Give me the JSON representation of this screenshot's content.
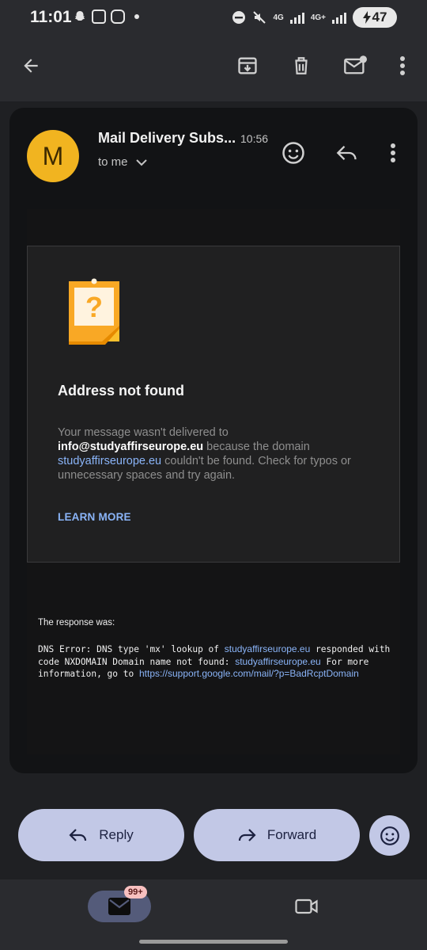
{
  "status_bar": {
    "time": "11:01",
    "network_1": "4G",
    "network_2": "4G+",
    "battery": "47"
  },
  "toolbar": {
    "icons": [
      "back-arrow-icon",
      "archive-icon",
      "delete-icon",
      "mark-unread-icon",
      "more-vert-icon"
    ]
  },
  "message": {
    "avatar_letter": "M",
    "sender": "Mail Delivery Subs...",
    "time": "10:56",
    "recipient": "to me"
  },
  "bounce": {
    "title": "Address not found",
    "text_1": "Your message wasn't delivered to",
    "email": "info@studyaffirseurope.eu",
    "text_2": " because the domain",
    "domain": "studyaffirseurope.eu",
    "text_3": " couldn't be found. Check for typos or unnecessary spaces and try again.",
    "learn_more": "LEARN MORE",
    "response_label": "The response was:",
    "dns_1": "DNS Error: DNS type 'mx' lookup of ",
    "dns_domain_1": "studyaffirseurope.eu",
    "dns_2": " responded with code NXDOMAIN Domain name not found: ",
    "dns_domain_2": "studyaffirseurope.eu",
    "dns_3": " For more information, go to ",
    "dns_link": "https://support.google.com/mail/?p=BadRcptDomain"
  },
  "actions": {
    "reply": "Reply",
    "forward": "Forward"
  },
  "bottom_nav": {
    "mail_badge": "99+"
  },
  "colors": {
    "accent": "#8ab4f8",
    "avatar": "#f1b420",
    "pill": "#c2c8e6"
  }
}
